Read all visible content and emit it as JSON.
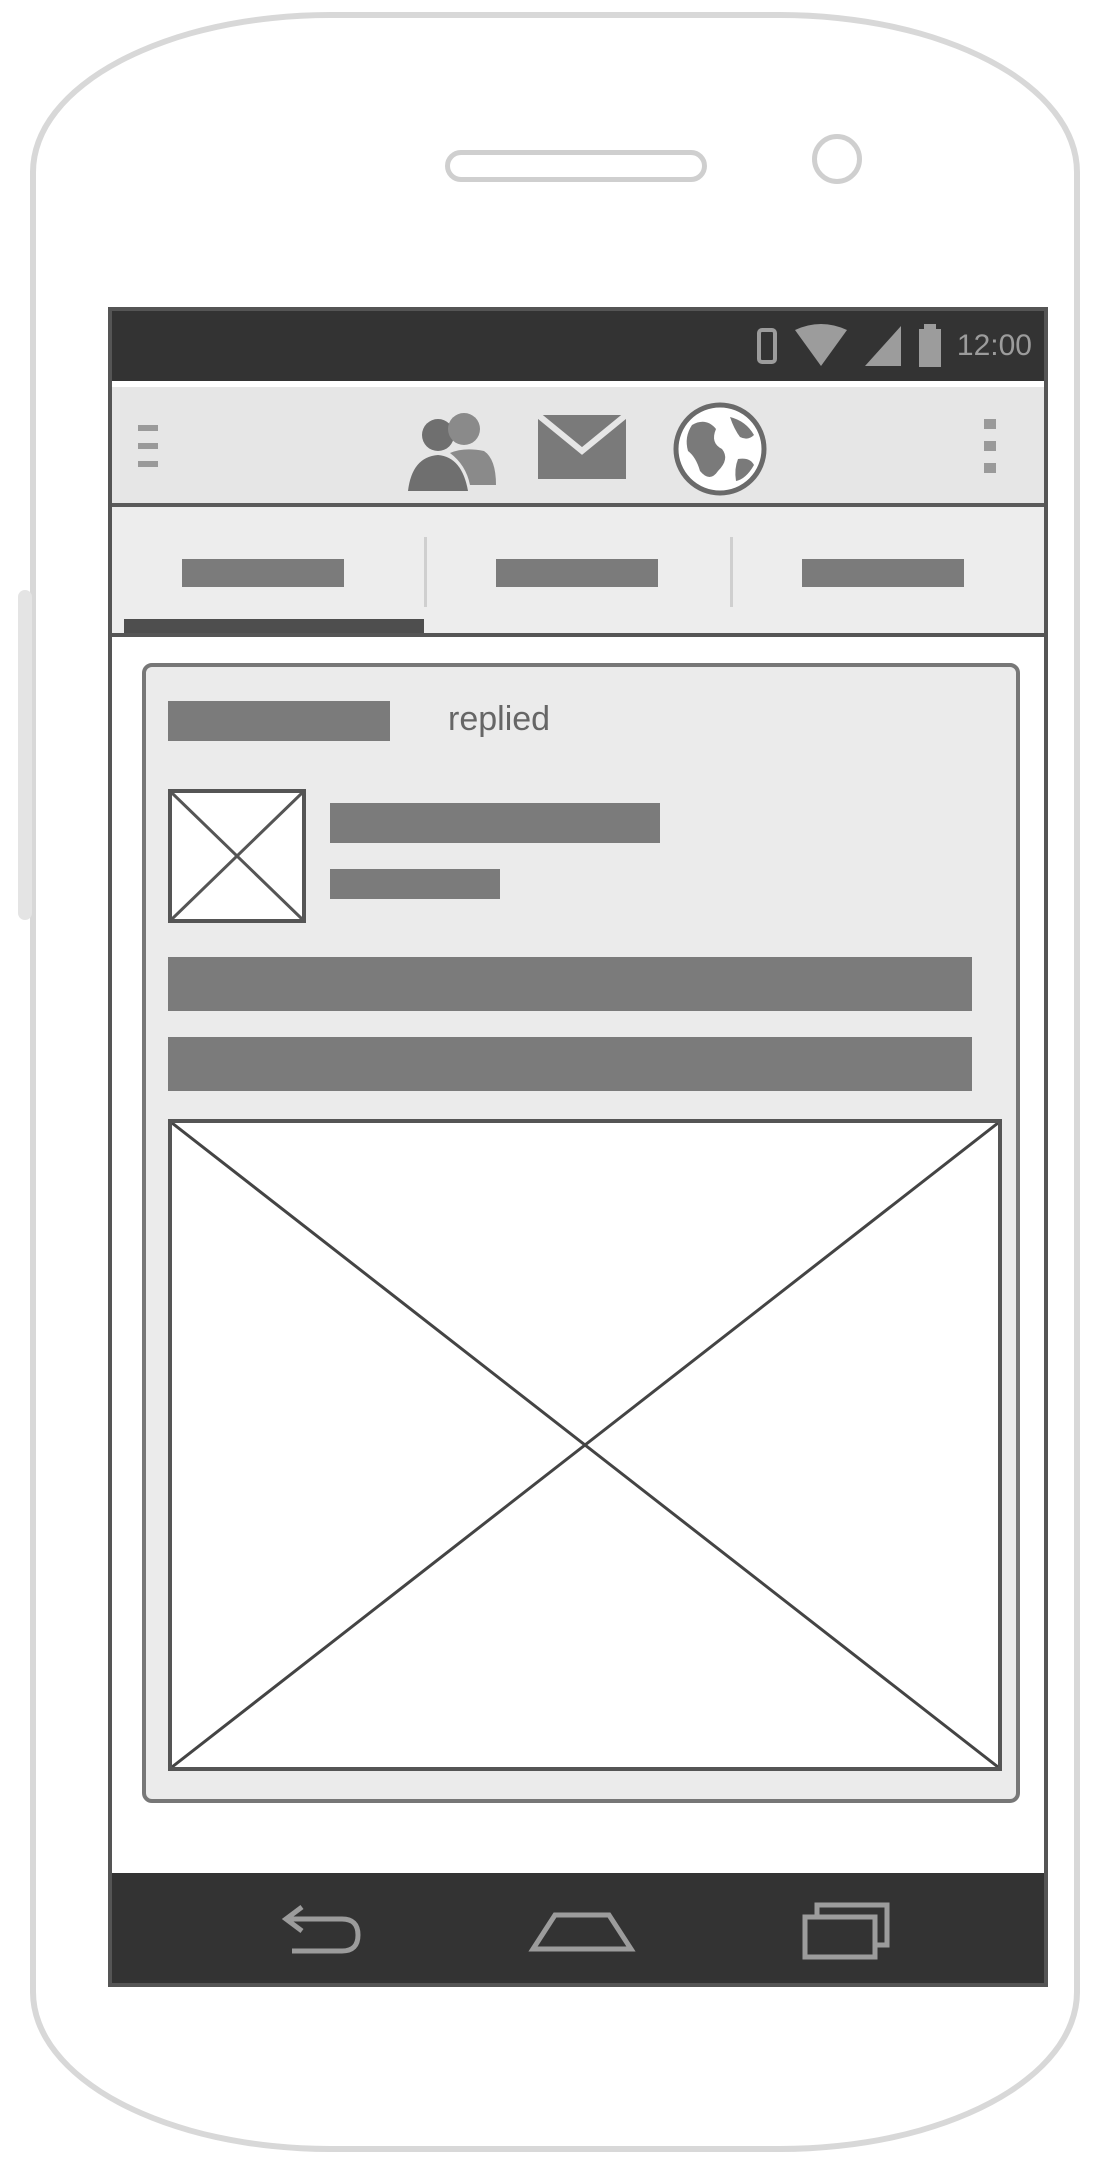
{
  "status_bar": {
    "time": "12:00",
    "icons": [
      "vibrate-icon",
      "wifi-icon",
      "signal-icon",
      "battery-icon"
    ]
  },
  "action_bar": {
    "icons": [
      "menu-icon",
      "people-icon",
      "mail-icon",
      "globe-icon",
      "overflow-menu-icon"
    ]
  },
  "tabs": [
    {
      "label": "",
      "selected": true
    },
    {
      "label": "",
      "selected": false
    },
    {
      "label": "",
      "selected": false
    }
  ],
  "card": {
    "user_name": "",
    "action_text": "replied",
    "title": "",
    "subtitle": "",
    "body_lines": [
      "",
      ""
    ],
    "thumbnail": "image-placeholder",
    "media": "image-placeholder"
  },
  "nav_bar": {
    "icons": [
      "back-icon",
      "home-icon",
      "recent-apps-icon"
    ]
  },
  "colors": {
    "status_bar": "#333333",
    "action_bar": "#e6e6e6",
    "placeholder_text": "#7b7b7b",
    "card_background": "#ebebeb"
  }
}
